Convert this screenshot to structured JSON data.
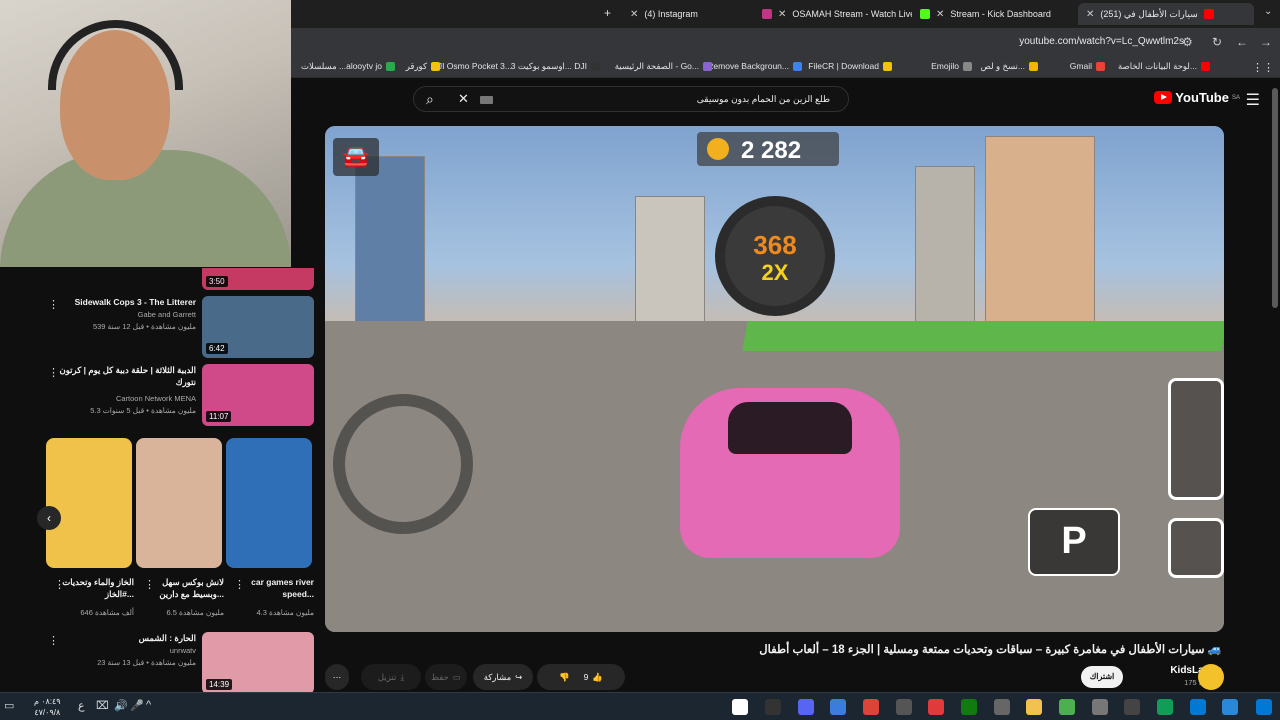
{
  "browser": {
    "tabs": [
      {
        "label": "(4) Instagram",
        "color": "#c13584"
      },
      {
        "label": "OSAMAH Stream - Watch Live",
        "color": "#53fc18"
      },
      {
        "label": "Stream - Kick Dashboard",
        "color": "#53fc18"
      },
      {
        "label": "(251) سيارات الأطفال في",
        "color": "#ff0000",
        "active": true
      }
    ],
    "url": "youtube.com/watch?v=Lc_Qwwtlm2s",
    "bookmarks": [
      {
        "label": "لوحة البيانات الخاصة...",
        "color": "#ff0000"
      },
      {
        "label": "Gmail",
        "color": "#ea4335"
      },
      {
        "label": "نسخ و لص...",
        "color": "#f4b400"
      },
      {
        "label": "Emojilo",
        "color": "#888888"
      },
      {
        "label": "FileCR | Download",
        "color": "#f4c20d"
      },
      {
        "label": "Remove Backgroun...",
        "color": "#3b82f6"
      },
      {
        "label": "الصفحة الرئيسية - Go...",
        "color": "#8a63d2"
      },
      {
        "label": "اوسمو بوكيت 3... DJI",
        "color": "#333333"
      },
      {
        "label": "DJI Osmo Pocket 3...",
        "color": "#333333"
      },
      {
        "label": "كورقر",
        "color": "#f4c20d"
      },
      {
        "label": "مسلسلات ...alooytv jo",
        "color": "#2aa94f"
      }
    ]
  },
  "youtube": {
    "search_query": "طلع الزين من الحمام بدون موسيقى",
    "logo": "YouTube",
    "logo_region": "SA"
  },
  "video": {
    "title": "سيارات الأطفال في مغامرة كبيرة – سباقات وتحديات ممتعة ومسلية | الجزء 18 – ألعاب أطفال 🚙",
    "channel_name": "KidsLando",
    "subscribers": "175 مشترك",
    "subscribe_label": "اشتراك",
    "likes": "9",
    "share_label": "مشاركة",
    "save_label": "حفظ",
    "download_label": "تنزيل",
    "game": {
      "coins": "2 282",
      "wheel_value": "368",
      "multiplier": "2X",
      "parking_label": "P"
    }
  },
  "sidebar": {
    "recs": [
      {
        "title": "Sidewalk Cops 3 - The Litterer",
        "channel": "Gabe and Garrett",
        "meta": "539 مليون مشاهدة • قبل 12 سنة",
        "duration": "6:42",
        "thumb": "#4a6a8a"
      },
      {
        "title": "الدببة الثلاثة | حلقة دببة كل يوم | كرتون نتورك",
        "channel": "Cartoon Network MENA",
        "meta": "5.3 مليون مشاهدة • قبل 5 سنوات",
        "duration": "11:07",
        "thumb": "#d04a8a"
      },
      {
        "title": "الحارة : الشمس",
        "channel": "unrwatv",
        "meta": "23 مليون مشاهدة • قبل 13 سنة",
        "duration": "14:39",
        "thumb": "#e09aa8"
      }
    ],
    "top_duration": "3:50",
    "shorts": [
      {
        "title": "car games river speed...",
        "views": "4.3 مليون مشاهدة",
        "color": "#2f6fb8"
      },
      {
        "title": "لانش بوكس سهل وبسيط مع دارين...",
        "views": "6.5 مليون مشاهدة",
        "color": "#d9b49a"
      },
      {
        "title": "الخاز والماء وتحديات #الخاز...",
        "views": "646 ألف مشاهدة",
        "color": "#f0c24a"
      }
    ]
  },
  "taskbar": {
    "time": "٠٨:٤٩ م",
    "date": "٤٧/٠٩/٨"
  }
}
